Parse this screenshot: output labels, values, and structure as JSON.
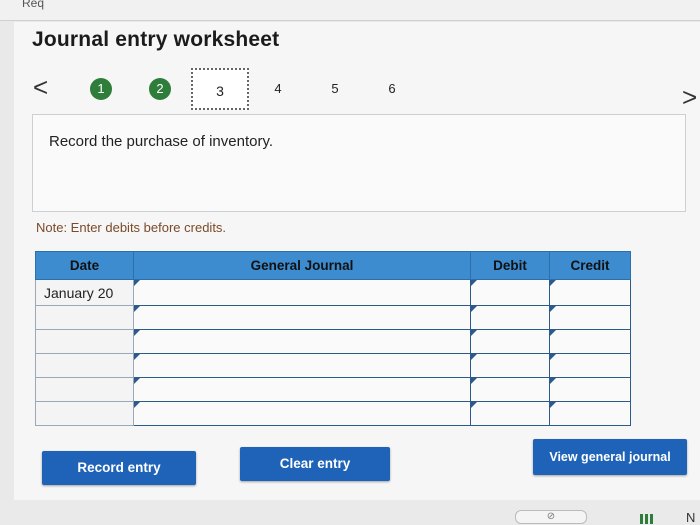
{
  "header": {
    "top_text": "Req",
    "title": "Journal entry worksheet"
  },
  "navigation": {
    "prev_icon": "chevron-left",
    "next_icon": "chevron-right",
    "prev_glyph": "<",
    "next_glyph": ">",
    "steps": [
      {
        "label": "1",
        "state": "completed"
      },
      {
        "label": "2",
        "state": "completed"
      },
      {
        "label": "3",
        "state": "current"
      },
      {
        "label": "4",
        "state": "pending"
      },
      {
        "label": "5",
        "state": "pending"
      },
      {
        "label": "6",
        "state": "pending"
      }
    ]
  },
  "instruction": "Record the purchase of inventory.",
  "note": "Note: Enter debits before credits.",
  "journal": {
    "columns": [
      "Date",
      "General Journal",
      "Debit",
      "Credit"
    ],
    "rows": [
      {
        "date": "January 20",
        "account": "",
        "debit": "",
        "credit": ""
      },
      {
        "date": "",
        "account": "",
        "debit": "",
        "credit": ""
      },
      {
        "date": "",
        "account": "",
        "debit": "",
        "credit": ""
      },
      {
        "date": "",
        "account": "",
        "debit": "",
        "credit": ""
      },
      {
        "date": "",
        "account": "",
        "debit": "",
        "credit": ""
      },
      {
        "date": "",
        "account": "",
        "debit": "",
        "credit": ""
      }
    ]
  },
  "buttons": {
    "record": "Record entry",
    "clear": "Clear entry",
    "view": "View general journal"
  },
  "footer": {
    "link_icon": "link-icon",
    "link_glyph": "⊘",
    "grid_icon": "grid-icon",
    "next_label": "N"
  },
  "colors": {
    "header_blue": "#3c8ccf",
    "button_blue": "#1f63b8",
    "step_green": "#2f7d3a",
    "note_brown": "#7a4a2a"
  }
}
